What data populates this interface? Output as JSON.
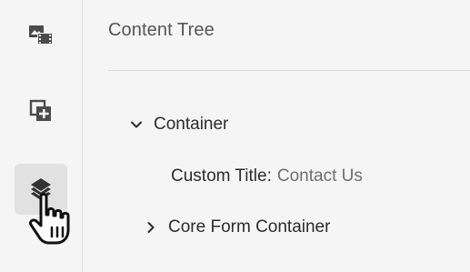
{
  "panel": {
    "title": "Content Tree"
  },
  "rail": {
    "items": [
      {
        "icon": "media-icon",
        "active": false
      },
      {
        "icon": "components-icon",
        "active": false
      },
      {
        "icon": "layers-icon",
        "active": true
      }
    ]
  },
  "tree": {
    "root": {
      "label": "Container",
      "expanded": true
    },
    "property": {
      "key": "Custom Title:",
      "value": "Contact Us"
    },
    "child": {
      "label": "Core Form Container",
      "expanded": false
    }
  },
  "colors": {
    "background": "#f5f5f5",
    "active_rail": "#e1e1e1",
    "text": "#2c2c2c",
    "muted_text": "#6e6e6e",
    "icon": "#4b4b4b"
  }
}
